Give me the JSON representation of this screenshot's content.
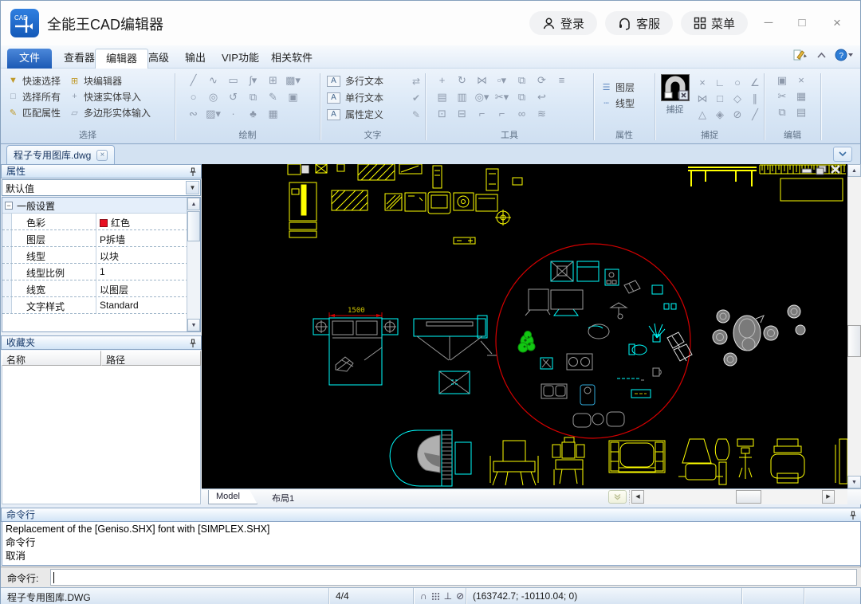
{
  "window": {
    "app_title": "全能王CAD编辑器",
    "login_label": "登录",
    "service_label": "客服",
    "menu_label": "菜单"
  },
  "menubar": {
    "tabs": [
      "文件",
      "查看器",
      "编辑器",
      "高级",
      "输出",
      "VIP功能",
      "相关软件"
    ],
    "active_tab": "编辑器"
  },
  "ribbon": {
    "select": {
      "label": "选择",
      "items": [
        {
          "label": "快速选择",
          "glyph": "▼"
        },
        {
          "label": "选择所有",
          "glyph": "□"
        },
        {
          "label": "匹配属性",
          "glyph": "✎"
        },
        {
          "label": "块编辑器",
          "glyph": "⊞"
        },
        {
          "label": "快速实体导入",
          "glyph": "+"
        },
        {
          "label": "多边形实体输入",
          "glyph": "▱"
        }
      ]
    },
    "draw": {
      "label": "绘制",
      "icons": [
        {
          "name": "line",
          "glyph": "╱"
        },
        {
          "name": "polyline",
          "glyph": "∿"
        },
        {
          "name": "rectangle",
          "glyph": "▭"
        },
        {
          "name": "spline",
          "glyph": "ʃ▾"
        },
        {
          "name": "insert-block",
          "glyph": "⊞"
        },
        {
          "name": "boundary",
          "glyph": "▩▾"
        },
        {
          "name": "circle",
          "glyph": "○"
        },
        {
          "name": "ellipse",
          "glyph": "◎"
        },
        {
          "name": "arc",
          "glyph": "↺"
        },
        {
          "name": "copy-object",
          "glyph": "⧉"
        },
        {
          "name": "freehand",
          "glyph": "✎"
        },
        {
          "name": "region",
          "glyph": "▣"
        },
        {
          "name": "revision-cloud",
          "glyph": "∾"
        },
        {
          "name": "hatch",
          "glyph": "▨▾"
        },
        {
          "name": "point",
          "glyph": "·"
        },
        {
          "name": "vegetation",
          "glyph": "♣"
        },
        {
          "name": "table",
          "glyph": "▦"
        }
      ]
    },
    "text": {
      "label": "文字",
      "items": [
        "多行文本",
        "单行文本",
        "属性定义"
      ],
      "row_icon": "A",
      "side_icons": [
        {
          "name": "find-replace",
          "glyph": "⇄"
        },
        {
          "name": "spell-check",
          "glyph": "✔"
        },
        {
          "name": "edit-text",
          "glyph": "✎"
        }
      ]
    },
    "tools": {
      "label": "工具",
      "icons": [
        {
          "name": "move",
          "glyph": "+"
        },
        {
          "name": "rotate",
          "glyph": "↻"
        },
        {
          "name": "mirror",
          "glyph": "⋈"
        },
        {
          "name": "offset",
          "glyph": "▫▾"
        },
        {
          "name": "copy-nested",
          "glyph": "⧉"
        },
        {
          "name": "rotate-copy",
          "glyph": "⟳"
        },
        {
          "name": "align",
          "glyph": "≡"
        },
        {
          "name": "new-view",
          "glyph": "▤"
        },
        {
          "name": "named-view",
          "glyph": "▥"
        },
        {
          "name": "zoom-select",
          "glyph": "◎▾"
        },
        {
          "name": "trim",
          "glyph": "✂▾"
        },
        {
          "name": "copy-pair",
          "glyph": "⧉"
        },
        {
          "name": "undo-mark",
          "glyph": "↩"
        },
        {
          "name": "scale-down",
          "glyph": "⊡"
        },
        {
          "name": "scale-up",
          "glyph": "⊟"
        },
        {
          "name": "fillet",
          "glyph": "⌐"
        },
        {
          "name": "chamfer",
          "glyph": "⌐"
        },
        {
          "name": "link",
          "glyph": "∞"
        },
        {
          "name": "layer-merge",
          "glyph": "≋"
        }
      ]
    },
    "props": {
      "label": "属性",
      "items": [
        {
          "label": "图层",
          "glyph": "☰"
        },
        {
          "label": "线型",
          "glyph": "┄"
        }
      ]
    },
    "snap": {
      "label": "捕捉",
      "big_button_label": "捕捉",
      "icons": [
        {
          "name": "snap-disable",
          "glyph": "×"
        },
        {
          "name": "snap-perpendicular",
          "glyph": "∟"
        },
        {
          "name": "snap-center",
          "glyph": "○"
        },
        {
          "name": "snap-extension",
          "glyph": "∠"
        },
        {
          "name": "snap-apparent-intersection",
          "glyph": "⋈"
        },
        {
          "name": "snap-node",
          "glyph": "□"
        },
        {
          "name": "snap-polygon",
          "glyph": "◇"
        },
        {
          "name": "snap-parallel",
          "glyph": "∥"
        },
        {
          "name": "snap-intersection",
          "glyph": "△"
        },
        {
          "name": "snap-quadrant",
          "glyph": "◈"
        },
        {
          "name": "snap-tangent",
          "glyph": "⊘"
        },
        {
          "name": "snap-nearest",
          "glyph": "╱"
        }
      ]
    },
    "edit": {
      "label": "编辑",
      "icons": [
        {
          "name": "paste",
          "glyph": "▣"
        },
        {
          "name": "erase",
          "glyph": "×"
        },
        {
          "name": "cut",
          "glyph": "✂"
        },
        {
          "name": "paste-special",
          "glyph": "▦"
        },
        {
          "name": "copy",
          "glyph": "⧉"
        },
        {
          "name": "copy-with-base",
          "glyph": "▤"
        }
      ]
    }
  },
  "doc_tab": {
    "title": "程子专用图库.dwg"
  },
  "properties": {
    "title": "属性",
    "preset": "默认值",
    "group": "一般设置",
    "swatch_color": "#e81123",
    "rows": [
      {
        "label": "色彩",
        "value": "红色"
      },
      {
        "label": "图层",
        "value": "P拆墙"
      },
      {
        "label": "线型",
        "value": "以块"
      },
      {
        "label": "线型比例",
        "value": "1"
      },
      {
        "label": "线宽",
        "value": "以图层"
      },
      {
        "label": "文字样式",
        "value": "Standard"
      }
    ]
  },
  "favorites": {
    "title": "收藏夹",
    "col_name": "名称",
    "col_path": "路径"
  },
  "canvas": {
    "model_tab": "Model",
    "layout_tab": "布局1",
    "dim_label": "1500"
  },
  "command": {
    "title": "命令行",
    "log_lines": [
      "Replacement of the [Geniso.SHX] font with [SIMPLEX.SHX]",
      "命令行",
      "取消"
    ],
    "prompt_label": "命令行:",
    "input_value": ""
  },
  "status": {
    "filename": "程子专用图库.DWG",
    "counter": "4/4",
    "coords": "(163742.7; -10110.04; 0)",
    "icons": [
      {
        "name": "snap-magnet",
        "glyph": "∩"
      },
      {
        "name": "ortho-perpendicular",
        "glyph": "⊥"
      },
      {
        "name": "tangent-tool",
        "glyph": "⊘"
      }
    ]
  },
  "ui": {
    "arrow_up": "▲",
    "arrow_down": "▼",
    "arrow_left": "◀",
    "arrow_right": "▶",
    "dropdown_arrow": "▼",
    "minus": "−",
    "close": "×",
    "win_minimize": "─",
    "win_maximize": "□",
    "win_close": "×"
  },
  "colors": {
    "accent_blue": "#2f6fc4",
    "cad_yellow": "#ffff00",
    "cad_cyan": "#00ffff",
    "cad_red": "#d40000",
    "cad_green": "#12c812",
    "swatch_red": "#e81123"
  }
}
